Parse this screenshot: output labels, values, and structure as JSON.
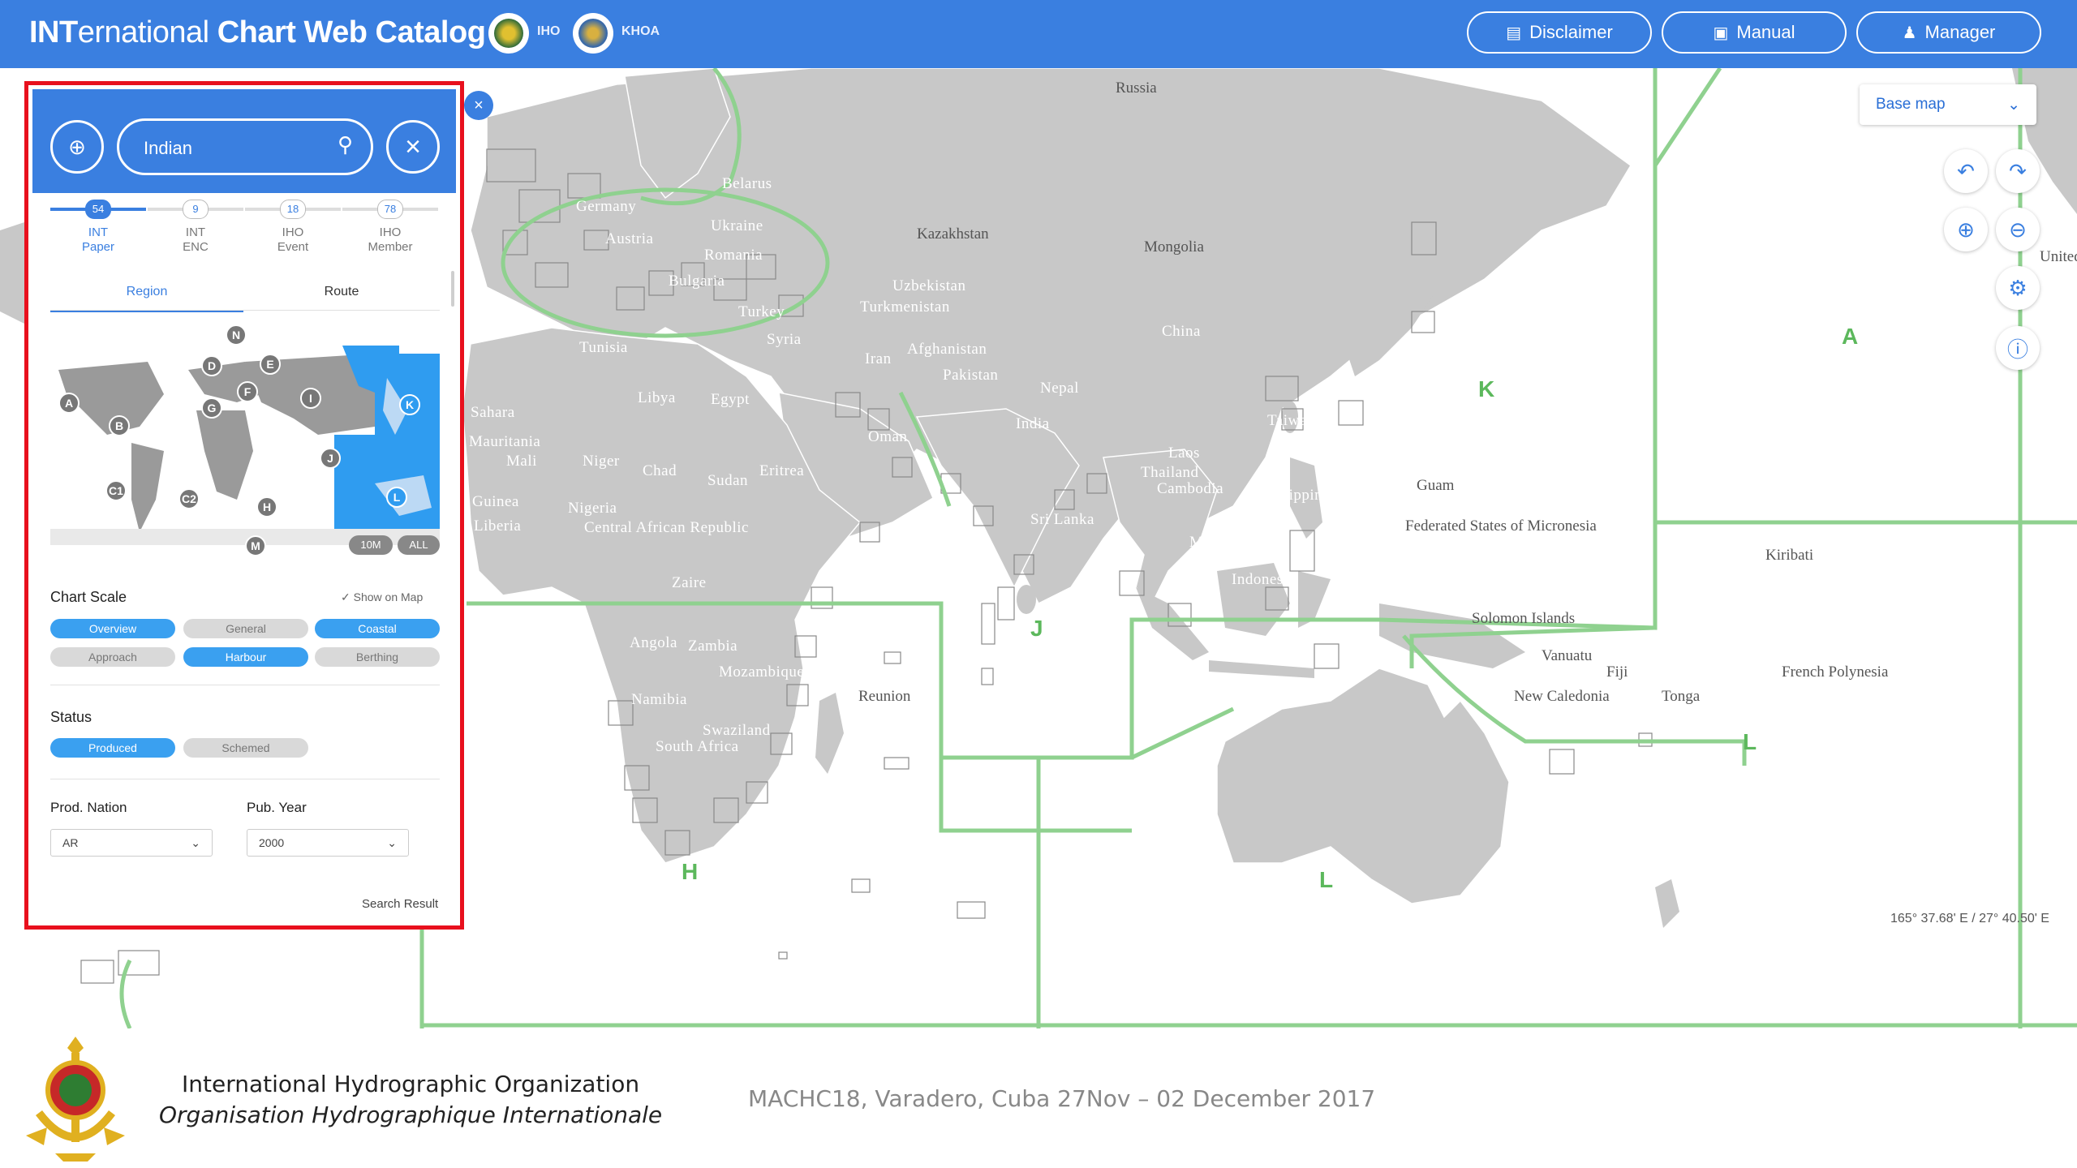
{
  "header": {
    "title_bold": "INT",
    "title_light": "ernational",
    "title_rest": "Chart Web Catalog",
    "orgs": [
      "IHO",
      "KHOA"
    ],
    "buttons": [
      "Disclaimer",
      "Manual",
      "Manager"
    ]
  },
  "search": {
    "value": "Indian"
  },
  "categories": [
    {
      "line1": "INT",
      "line2": "Paper",
      "count": "54"
    },
    {
      "line1": "INT",
      "line2": "ENC",
      "count": "9"
    },
    {
      "line1": "IHO",
      "line2": "Event",
      "count": "18"
    },
    {
      "line1": "IHO",
      "line2": "Member",
      "count": "78"
    }
  ],
  "subtabs": [
    "Region",
    "Route"
  ],
  "region_pins": [
    "N",
    "D",
    "E",
    "A",
    "F",
    "I",
    "G",
    "B",
    "K",
    "J",
    "C1",
    "C2",
    "H",
    "L",
    "M"
  ],
  "zoom_pills": [
    "10M",
    "ALL"
  ],
  "chart_scale": {
    "title": "Chart Scale",
    "show_on_map": "Show on Map",
    "chips": [
      {
        "label": "Overview",
        "on": true
      },
      {
        "label": "General",
        "on": false
      },
      {
        "label": "Coastal",
        "on": true
      },
      {
        "label": "Approach",
        "on": false
      },
      {
        "label": "Harbour",
        "on": true
      },
      {
        "label": "Berthing",
        "on": false
      }
    ]
  },
  "status": {
    "title": "Status",
    "chips": [
      {
        "label": "Produced",
        "on": true
      },
      {
        "label": "Schemed",
        "on": false
      }
    ]
  },
  "filters": {
    "prod_nation_label": "Prod. Nation",
    "prod_nation_value": "AR",
    "pub_year_label": "Pub. Year",
    "pub_year_value": "2000"
  },
  "search_result": "Search Result",
  "map": {
    "basemap_label": "Base map",
    "coords": "165° 37.68' E  /  27° 40.50' E",
    "zones": [
      "A",
      "K",
      "J",
      "H",
      "L",
      "L"
    ],
    "places": [
      "Russia",
      "Kazakhstan",
      "Mongolia",
      "Uzbekistan",
      "Turkmenistan",
      "China",
      "Iran",
      "Afghanistan",
      "Pakistan",
      "Nepal",
      "India",
      "Ukraine",
      "Romania",
      "Bulgaria",
      "Turkey",
      "Syria",
      "Austria",
      "Germany",
      "Tunisia",
      "Libya",
      "Egypt",
      "Oman",
      "Sudan",
      "Chad",
      "Niger",
      "Mali",
      "Sahara",
      "Nigeria",
      "Central African Republic",
      "Zaire",
      "Angola",
      "Zambia",
      "Mozambique",
      "Namibia",
      "Swaziland",
      "South Africa",
      "Laos",
      "Thailand",
      "Cambodia",
      "Philippines",
      "Malaysia",
      "Indonesia",
      "Taiwan",
      "Guam",
      "Federated States of Micronesia",
      "Kiribati",
      "Solomon Islands",
      "Vanuatu",
      "Fiji",
      "New Caledonia",
      "Tonga",
      "French Polynesia",
      "Sri Lanka",
      "Eritrea",
      "Reunion",
      "Belarus",
      "Liberia",
      "Guinea",
      "Mauritania",
      "United"
    ]
  },
  "footer": {
    "org_en": "International Hydrographic Organization",
    "org_fr": "Organisation Hydrographique Internationale",
    "conference": "MACHC18, Varadero, Cuba 27Nov – 02 December 2017"
  },
  "colors": {
    "header": "#3a7fe0",
    "land": "#c8c8c8",
    "zone_line": "#8fd18f",
    "highlight": "#e8101d",
    "chip_on": "#3aa0f0"
  }
}
